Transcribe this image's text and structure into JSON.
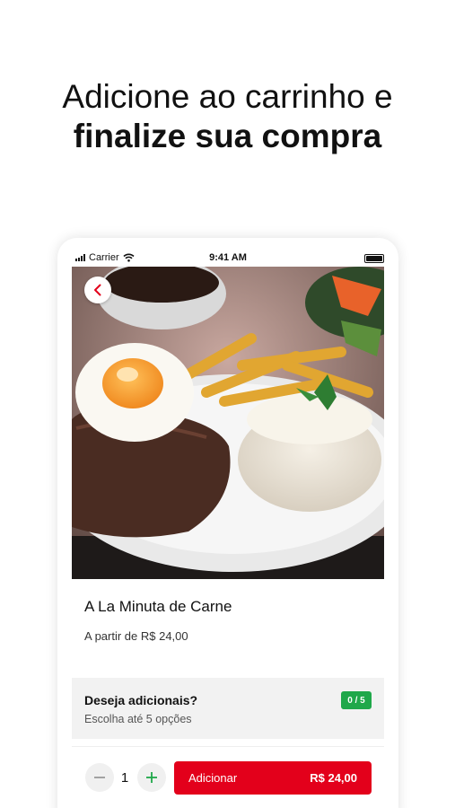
{
  "headline": {
    "line1": "Adicione ao carrinho e",
    "line2": "finalize sua compra"
  },
  "status_bar": {
    "carrier": "Carrier",
    "time": "9:41 AM"
  },
  "product": {
    "name": "A La Minuta de Carne",
    "price": "A partir de R$ 24,00"
  },
  "addons": {
    "title": "Deseja adicionais?",
    "subtitle": "Escolha até 5 opções",
    "badge": "0 / 5"
  },
  "cart": {
    "quantity": "1",
    "add_label": "Adicionar",
    "total": "R$ 24,00"
  },
  "colors": {
    "accent": "#e3001b",
    "badge": "#1fa84a",
    "plus_icon": "#1fa84a"
  }
}
